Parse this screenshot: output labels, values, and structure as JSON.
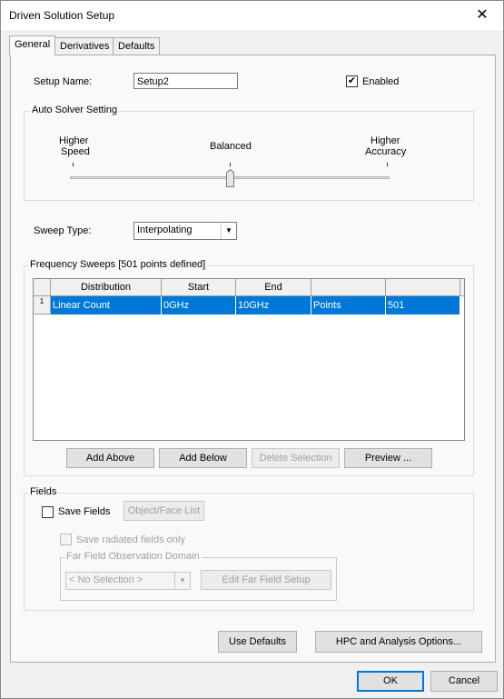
{
  "window": {
    "title": "Driven Solution Setup",
    "close_glyph": "✕"
  },
  "tabs": [
    {
      "label": "General"
    },
    {
      "label": "Derivatives"
    },
    {
      "label": "Defaults"
    }
  ],
  "general": {
    "setup_name_label": "Setup Name:",
    "setup_name_value": "Setup2",
    "enabled_label": "Enabled",
    "enabled_checked": true,
    "auto_solver": {
      "group_title": "Auto Solver Setting",
      "left_label_1": "Higher",
      "left_label_2": "Speed",
      "center_label": "Balanced",
      "right_label_1": "Higher",
      "right_label_2": "Accuracy",
      "slider_level": 0.5
    },
    "sweep_type_label": "Sweep Type:",
    "sweep_type_value": "Interpolating",
    "freq_sweeps": {
      "group_title": "Frequency Sweeps [501 points defined]",
      "columns": [
        "Distribution",
        "Start",
        "End",
        "",
        ""
      ],
      "rows": [
        {
          "index": "1",
          "cells": [
            "Linear Count",
            "0GHz",
            "10GHz",
            "Points",
            "501"
          ]
        }
      ],
      "buttons": [
        "Add Above",
        "Add Below",
        "Delete Selection",
        "Preview ..."
      ]
    },
    "fields": {
      "group_title": "Fields",
      "save_fields_label": "Save Fields",
      "object_face_list_label": "Object/Face List",
      "save_radiated_label": "Save radiated fields only",
      "far_field_group_title": "Far Field Observation Domain",
      "no_selection_value": "< No Selection >",
      "edit_far_field_label": "Edit Far Field Setup"
    },
    "use_defaults_label": "Use Defaults",
    "hpc_label": "HPC and Analysis Options..."
  },
  "footer": {
    "ok_label": "OK",
    "cancel_label": "Cancel"
  }
}
